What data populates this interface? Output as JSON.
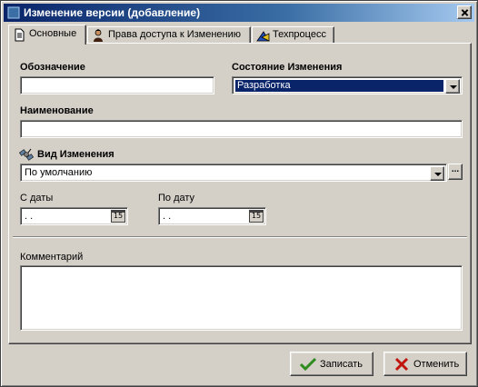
{
  "window": {
    "title": "Изменение версии (добавление)"
  },
  "tabs": [
    {
      "label": "Основные",
      "icon": "document-icon"
    },
    {
      "label": "Права доступа к Изменению",
      "icon": "user-icon"
    },
    {
      "label": "Техпроцесс",
      "icon": "process-icon"
    }
  ],
  "form": {
    "designation_label": "Обозначение",
    "designation_value": "",
    "state_label": "Состояние Изменения",
    "state_value": "Разработка",
    "name_label": "Наименование",
    "name_value": "",
    "change_type_label": "Вид Изменения",
    "change_type_value": "По умолчанию",
    "ellipsis": "...",
    "date_from_label": "С даты",
    "date_from_value": ". .",
    "date_to_label": "По дату",
    "date_to_value": ". .",
    "calendar_text": "15",
    "comment_label": "Комментарий",
    "comment_value": ""
  },
  "buttons": {
    "save": "Записать",
    "cancel": "Отменить"
  },
  "colors": {
    "title_start": "#0a246a",
    "selection": "#0a246a",
    "face": "#d4d0c8",
    "save_check": "#2e8b1e",
    "cancel_x": "#c0140c"
  }
}
